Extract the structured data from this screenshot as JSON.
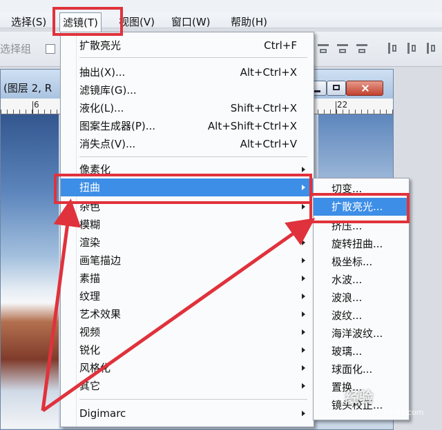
{
  "menubar": {
    "items": [
      "选择(S)",
      "滤镜(T)",
      "视图(V)",
      "窗口(W)",
      "帮助(H)"
    ]
  },
  "optionsbar": {
    "select_group_label": "选择组"
  },
  "document": {
    "title": "(图层 2, R",
    "ruler_left": "6",
    "ruler_right": "22"
  },
  "filter_menu": {
    "last_filter": {
      "label": "扩散亮光",
      "shortcut": "Ctrl+F"
    },
    "group1": [
      {
        "label": "抽出(X)...",
        "shortcut": "Alt+Ctrl+X"
      },
      {
        "label": "滤镜库(G)...",
        "shortcut": ""
      },
      {
        "label": "液化(L)...",
        "shortcut": "Shift+Ctrl+X"
      },
      {
        "label": "图案生成器(P)...",
        "shortcut": "Alt+Shift+Ctrl+X"
      },
      {
        "label": "消失点(V)...",
        "shortcut": "Alt+Ctrl+V"
      }
    ],
    "group2": [
      "像素化",
      "扭曲",
      "杂色",
      "模糊",
      "渲染",
      "画笔描边",
      "素描",
      "纹理",
      "艺术效果",
      "视频",
      "锐化",
      "风格化",
      "其它"
    ],
    "highlighted": "扭曲",
    "group3": [
      "Digimarc"
    ]
  },
  "distort_submenu": {
    "items": [
      "切变...",
      "扩散亮光...",
      "挤压...",
      "旋转扭曲...",
      "极坐标...",
      "水波...",
      "波浪...",
      "波纹...",
      "海洋波纹...",
      "玻璃...",
      "球面化...",
      "置换...",
      "镜头校正..."
    ],
    "highlighted": "扩散亮光..."
  },
  "watermark": {
    "text": "经验",
    "subtext": "jingyan.baidu.com"
  },
  "colors": {
    "highlight": "#3d8ee7",
    "annotation": "#e0323c"
  }
}
